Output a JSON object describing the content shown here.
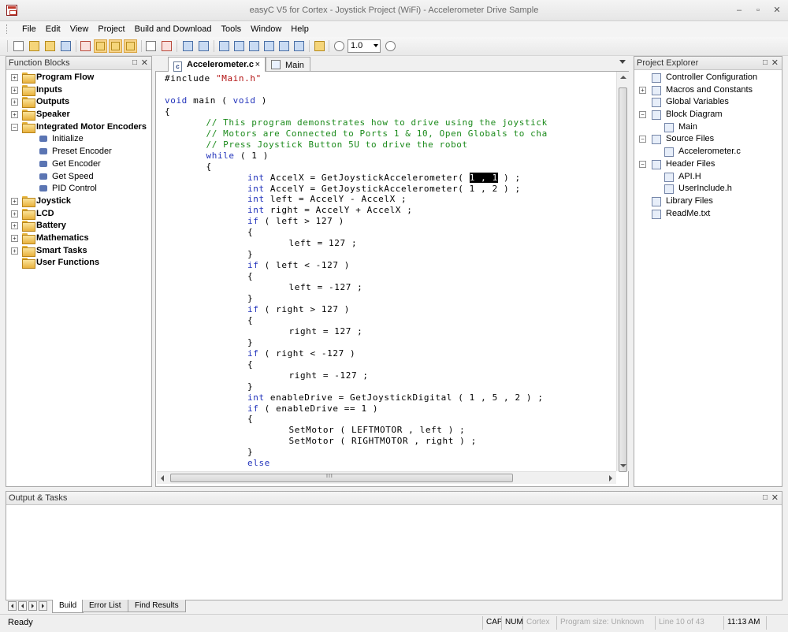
{
  "window": {
    "title": "easyC V5 for Cortex - Joystick Project (WiFi) - Accelerometer Drive Sample",
    "minimize": "–",
    "restore": "▫",
    "close": "✕"
  },
  "menu": [
    "File",
    "Edit",
    "View",
    "Project",
    "Build and Download",
    "Tools",
    "Window",
    "Help"
  ],
  "toolbar": {
    "zoom_value": "1.0"
  },
  "function_blocks": {
    "title": "Function Blocks",
    "items": [
      {
        "label": "Program Flow",
        "expanded": false
      },
      {
        "label": "Inputs",
        "expanded": false
      },
      {
        "label": "Outputs",
        "expanded": false
      },
      {
        "label": "Speaker",
        "expanded": false
      },
      {
        "label": "Integrated Motor Encoders",
        "expanded": true,
        "children": [
          "Initialize",
          "Preset Encoder",
          "Get Encoder",
          "Get Speed",
          "PID Control"
        ]
      },
      {
        "label": "Joystick",
        "expanded": false
      },
      {
        "label": "LCD",
        "expanded": false
      },
      {
        "label": "Battery",
        "expanded": false
      },
      {
        "label": "Mathematics",
        "expanded": false
      },
      {
        "label": "Smart Tasks",
        "expanded": false
      },
      {
        "label": "User Functions",
        "expanded": null
      }
    ]
  },
  "editor": {
    "tabs": [
      {
        "label": "Accelerometer.c",
        "close": "×",
        "active": true
      },
      {
        "label": "Main",
        "active": false
      }
    ],
    "lines": [
      {
        "indent": 0,
        "parts": [
          [
            "pp",
            "#include "
          ],
          [
            "str",
            "\"Main.h\""
          ]
        ]
      },
      {
        "indent": 0,
        "parts": []
      },
      {
        "indent": 0,
        "parts": [
          [
            "kw",
            "void"
          ],
          [
            "",
            " main ( "
          ],
          [
            "kw",
            "void"
          ],
          [
            "",
            " )"
          ]
        ]
      },
      {
        "indent": 0,
        "parts": [
          [
            "",
            "{"
          ]
        ]
      },
      {
        "indent": 1,
        "parts": [
          [
            "cm",
            "// This program demonstrates how to drive using the joystick"
          ]
        ]
      },
      {
        "indent": 1,
        "parts": [
          [
            "cm",
            "// Motors are Connected to Ports 1 & 10, Open Globals to cha"
          ]
        ]
      },
      {
        "indent": 1,
        "parts": [
          [
            "cm",
            "// Press Joystick Button 5U to drive the robot"
          ]
        ]
      },
      {
        "indent": 1,
        "parts": [
          [
            "kw",
            "while"
          ],
          [
            "",
            " ( 1 )"
          ]
        ]
      },
      {
        "indent": 1,
        "parts": [
          [
            "",
            "{"
          ]
        ]
      },
      {
        "indent": 2,
        "parts": [
          [
            "kw",
            "int"
          ],
          [
            "",
            " AccelX = GetJoystickAccelerometer( "
          ],
          [
            "sel",
            "1 , 1"
          ],
          [
            "",
            " ) ;"
          ]
        ]
      },
      {
        "indent": 2,
        "parts": [
          [
            "kw",
            "int"
          ],
          [
            "",
            " AccelY = GetJoystickAccelerometer( 1 , 2 ) ;"
          ]
        ]
      },
      {
        "indent": 2,
        "parts": [
          [
            "kw",
            "int"
          ],
          [
            "",
            " left = AccelY - AccelX ;"
          ]
        ]
      },
      {
        "indent": 2,
        "parts": [
          [
            "kw",
            "int"
          ],
          [
            "",
            " right = AccelY + AccelX ;"
          ]
        ]
      },
      {
        "indent": 2,
        "parts": [
          [
            "kw",
            "if"
          ],
          [
            "",
            " ( left > 127 )"
          ]
        ]
      },
      {
        "indent": 2,
        "parts": [
          [
            "",
            "{"
          ]
        ]
      },
      {
        "indent": 3,
        "parts": [
          [
            "",
            "left = 127 ;"
          ]
        ]
      },
      {
        "indent": 2,
        "parts": [
          [
            "",
            "}"
          ]
        ]
      },
      {
        "indent": 2,
        "parts": [
          [
            "kw",
            "if"
          ],
          [
            "",
            " ( left < -127 )"
          ]
        ]
      },
      {
        "indent": 2,
        "parts": [
          [
            "",
            "{"
          ]
        ]
      },
      {
        "indent": 3,
        "parts": [
          [
            "",
            "left = -127 ;"
          ]
        ]
      },
      {
        "indent": 2,
        "parts": [
          [
            "",
            "}"
          ]
        ]
      },
      {
        "indent": 2,
        "parts": [
          [
            "kw",
            "if"
          ],
          [
            "",
            " ( right > 127 )"
          ]
        ]
      },
      {
        "indent": 2,
        "parts": [
          [
            "",
            "{"
          ]
        ]
      },
      {
        "indent": 3,
        "parts": [
          [
            "",
            "right = 127 ;"
          ]
        ]
      },
      {
        "indent": 2,
        "parts": [
          [
            "",
            "}"
          ]
        ]
      },
      {
        "indent": 2,
        "parts": [
          [
            "kw",
            "if"
          ],
          [
            "",
            " ( right < -127 )"
          ]
        ]
      },
      {
        "indent": 2,
        "parts": [
          [
            "",
            "{"
          ]
        ]
      },
      {
        "indent": 3,
        "parts": [
          [
            "",
            "right = -127 ;"
          ]
        ]
      },
      {
        "indent": 2,
        "parts": [
          [
            "",
            "}"
          ]
        ]
      },
      {
        "indent": 2,
        "parts": [
          [
            "kw",
            "int"
          ],
          [
            "",
            " enableDrive = GetJoystickDigital ( 1 , 5 , 2 ) ;"
          ]
        ]
      },
      {
        "indent": 2,
        "parts": [
          [
            "kw",
            "if"
          ],
          [
            "",
            " ( enableDrive == 1 )"
          ]
        ]
      },
      {
        "indent": 2,
        "parts": [
          [
            "",
            "{"
          ]
        ]
      },
      {
        "indent": 3,
        "parts": [
          [
            "",
            "SetMotor ( LEFTMOTOR , left ) ;"
          ]
        ]
      },
      {
        "indent": 3,
        "parts": [
          [
            "",
            "SetMotor ( RIGHTMOTOR , right ) ;"
          ]
        ]
      },
      {
        "indent": 2,
        "parts": [
          [
            "",
            "}"
          ]
        ]
      },
      {
        "indent": 2,
        "parts": [
          [
            "kw",
            "else"
          ]
        ]
      }
    ],
    "hscroll_grip": "III"
  },
  "project_explorer": {
    "title": "Project Explorer",
    "items": [
      {
        "label": "Controller Configuration",
        "level": 0,
        "icon": "wrench-icon"
      },
      {
        "label": "Macros and Constants",
        "level": 0,
        "icon": "list-icon",
        "expander": "+"
      },
      {
        "label": "Global Variables",
        "level": 0,
        "icon": "diamond-icon"
      },
      {
        "label": "Block Diagram",
        "level": 0,
        "icon": "diagram-icon",
        "expander": "-"
      },
      {
        "label": "Main",
        "level": 1,
        "icon": "flowchart-icon"
      },
      {
        "label": "Source Files",
        "level": 0,
        "icon": "folder-icon",
        "expander": "-"
      },
      {
        "label": "Accelerometer.c",
        "level": 1,
        "icon": "c-file-icon"
      },
      {
        "label": "Header Files",
        "level": 0,
        "icon": "folder-icon",
        "expander": "-"
      },
      {
        "label": "API.H",
        "level": 1,
        "icon": "h-file-icon"
      },
      {
        "label": "UserInclude.h",
        "level": 1,
        "icon": "h-file-icon"
      },
      {
        "label": "Library Files",
        "level": 0,
        "icon": "folder-icon"
      },
      {
        "label": "ReadMe.txt",
        "level": 0,
        "icon": "text-file-icon"
      }
    ]
  },
  "output": {
    "title": "Output & Tasks",
    "tabs": [
      "Build",
      "Error List",
      "Find Results"
    ]
  },
  "status": {
    "ready": "Ready",
    "cap": "CAP",
    "num": "NUM",
    "target": "Cortex",
    "program_size": "Program size: Unknown",
    "line_position": "Line  10  of  43",
    "time": "11:13 AM"
  }
}
